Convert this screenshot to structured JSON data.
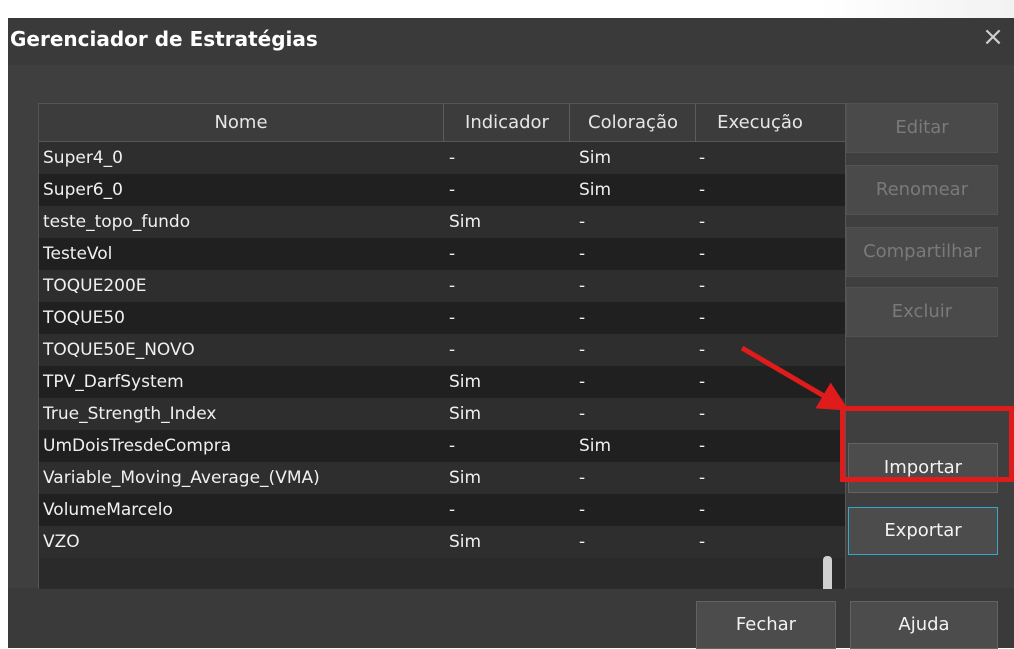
{
  "dialog": {
    "title": "Gerenciador de Estratégias",
    "close_icon": "×"
  },
  "table": {
    "headers": {
      "nome": "Nome",
      "indicador": "Indicador",
      "coloracao": "Coloração",
      "execucao": "Execução"
    },
    "rows": [
      {
        "nome": "Super4_0",
        "indicador": "-",
        "coloracao": "Sim",
        "execucao": "-"
      },
      {
        "nome": "Super6_0",
        "indicador": "-",
        "coloracao": "Sim",
        "execucao": "-"
      },
      {
        "nome": "teste_topo_fundo",
        "indicador": "Sim",
        "coloracao": "-",
        "execucao": "-"
      },
      {
        "nome": "TesteVol",
        "indicador": "-",
        "coloracao": "-",
        "execucao": "-"
      },
      {
        "nome": "TOQUE200E",
        "indicador": "-",
        "coloracao": "-",
        "execucao": "-"
      },
      {
        "nome": "TOQUE50",
        "indicador": "-",
        "coloracao": "-",
        "execucao": "-"
      },
      {
        "nome": "TOQUE50E_NOVO",
        "indicador": "-",
        "coloracao": "-",
        "execucao": "-"
      },
      {
        "nome": "TPV_DarfSystem",
        "indicador": "Sim",
        "coloracao": "-",
        "execucao": "-"
      },
      {
        "nome": "True_Strength_Index",
        "indicador": "Sim",
        "coloracao": "-",
        "execucao": "-"
      },
      {
        "nome": "UmDoisTresdeCompra",
        "indicador": "-",
        "coloracao": "Sim",
        "execucao": "-"
      },
      {
        "nome": "Variable_Moving_Average_(VMA)",
        "indicador": "Sim",
        "coloracao": "-",
        "execucao": "-"
      },
      {
        "nome": "VolumeMarcelo",
        "indicador": "-",
        "coloracao": "-",
        "execucao": "-"
      },
      {
        "nome": "VZO",
        "indicador": "Sim",
        "coloracao": "-",
        "execucao": "-"
      }
    ]
  },
  "side_buttons": {
    "editar": "Editar",
    "renomear": "Renomear",
    "compartilhar": "Compartilhar",
    "excluir": "Excluir",
    "importar": "Importar",
    "exportar": "Exportar"
  },
  "footer_buttons": {
    "fechar": "Fechar",
    "ajuda": "Ajuda"
  },
  "annotation": {
    "color": "#e01b1b"
  }
}
